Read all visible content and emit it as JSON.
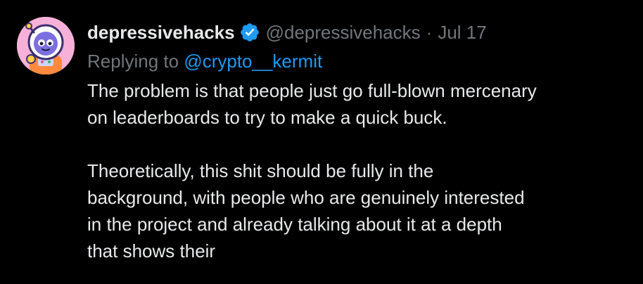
{
  "tweet": {
    "display_name": "depressivehacks",
    "handle": "@depressivehacks",
    "separator": "·",
    "date": "Jul 17",
    "replying_to_prefix": "Replying to",
    "replying_to_handle": "@crypto__kermit",
    "paragraph1": [
      "The problem is that people just go full-blown mercenary",
      "on leaderboards to try to make a quick buck."
    ],
    "paragraph2": [
      "Theoretically, this shit should be fully in the",
      "background, with people who are genuinely interested",
      "in the project and already talking about it at a depth",
      "that shows their"
    ]
  },
  "colors": {
    "background": "#000000",
    "text_primary": "#e7e9ea",
    "text_secondary": "#71767b",
    "link": "#1d9bf0",
    "verified_badge": "#1d9bf0",
    "avatar_bg": "#f7b1d8"
  },
  "icons": {
    "verified": "verified-badge-icon",
    "avatar": "astronaut-avatar"
  }
}
